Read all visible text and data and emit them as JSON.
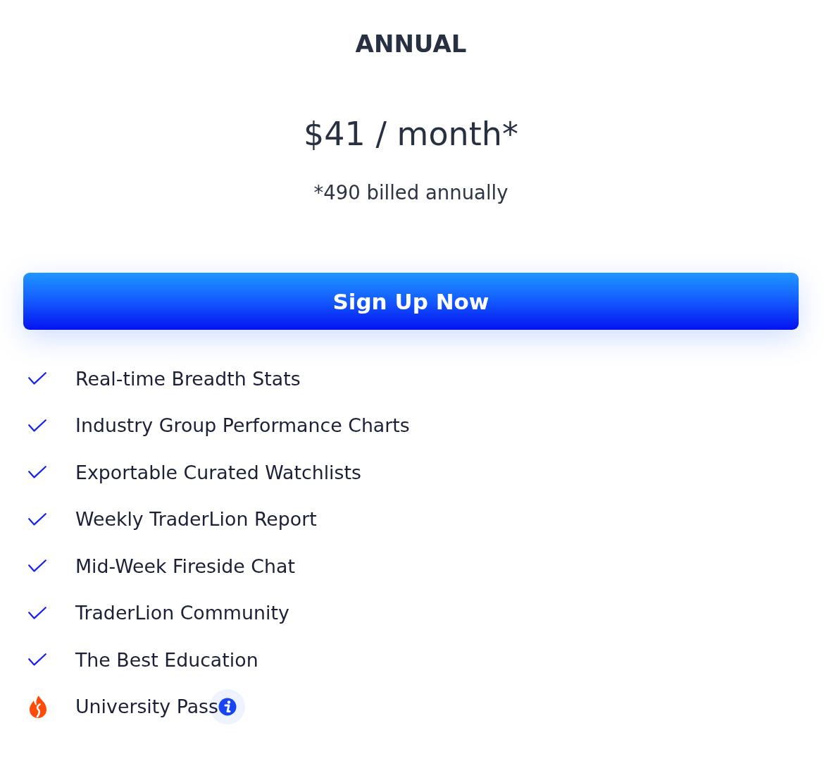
{
  "plan": {
    "title": "ANNUAL",
    "price": "$41 / month*",
    "billing_note": "*490 billed annually"
  },
  "signup_button": {
    "label": "Sign Up Now"
  },
  "features": [
    {
      "kind": "check",
      "label": "Real-time Breadth Stats",
      "info": false
    },
    {
      "kind": "check",
      "label": "Industry Group Performance Charts",
      "info": false
    },
    {
      "kind": "check",
      "label": "Exportable Curated Watchlists",
      "info": false
    },
    {
      "kind": "check",
      "label": "Weekly TraderLion Report",
      "info": false
    },
    {
      "kind": "check",
      "label": "Mid-Week Fireside Chat",
      "info": false
    },
    {
      "kind": "check",
      "label": "TraderLion Community",
      "info": false
    },
    {
      "kind": "check",
      "label": "The Best Education",
      "info": false
    },
    {
      "kind": "flame",
      "label": "University Pass",
      "info": true
    }
  ]
}
